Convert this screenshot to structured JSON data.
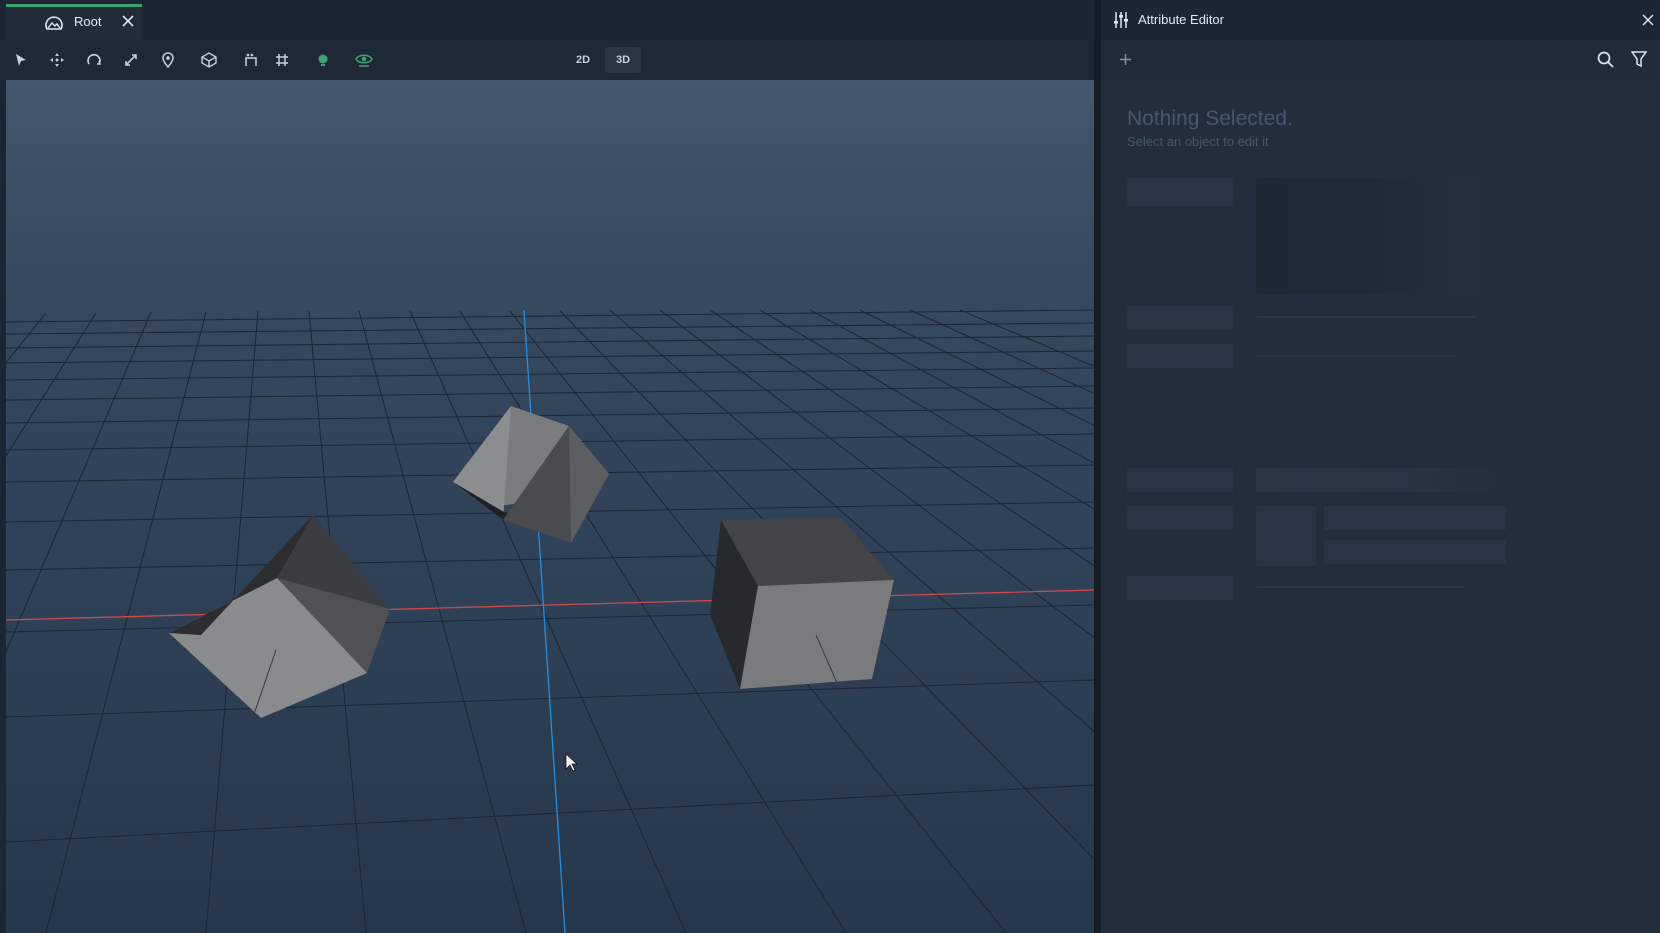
{
  "tab": {
    "label": "Root",
    "icon": "landscape-icon",
    "accent": "#3aa36e"
  },
  "toolbar": {
    "tools": [
      "select-arrow-icon",
      "move-icon",
      "rotate-icon",
      "scale-icon",
      "pin-icon",
      "geometry-icon",
      "transform-snap-icon",
      "grid-icon",
      "light-icon",
      "eye-icon"
    ],
    "view_2d": "2D",
    "view_3d": "3D",
    "active_view": "3D"
  },
  "panel": {
    "title": "Attribute Editor",
    "add_icon": "plus-icon",
    "search_icon": "search-icon",
    "filter_icon": "filter-icon",
    "close_icon": "close-icon",
    "empty_title": "Nothing Selected.",
    "empty_subtitle": "Select an object to edit it"
  },
  "scene": {
    "objects": [
      "cube",
      "cube",
      "cube"
    ],
    "x_axis_color": "#d14a4a",
    "z_axis_color": "#1e8fe6",
    "grid_color": "#1a2533"
  }
}
